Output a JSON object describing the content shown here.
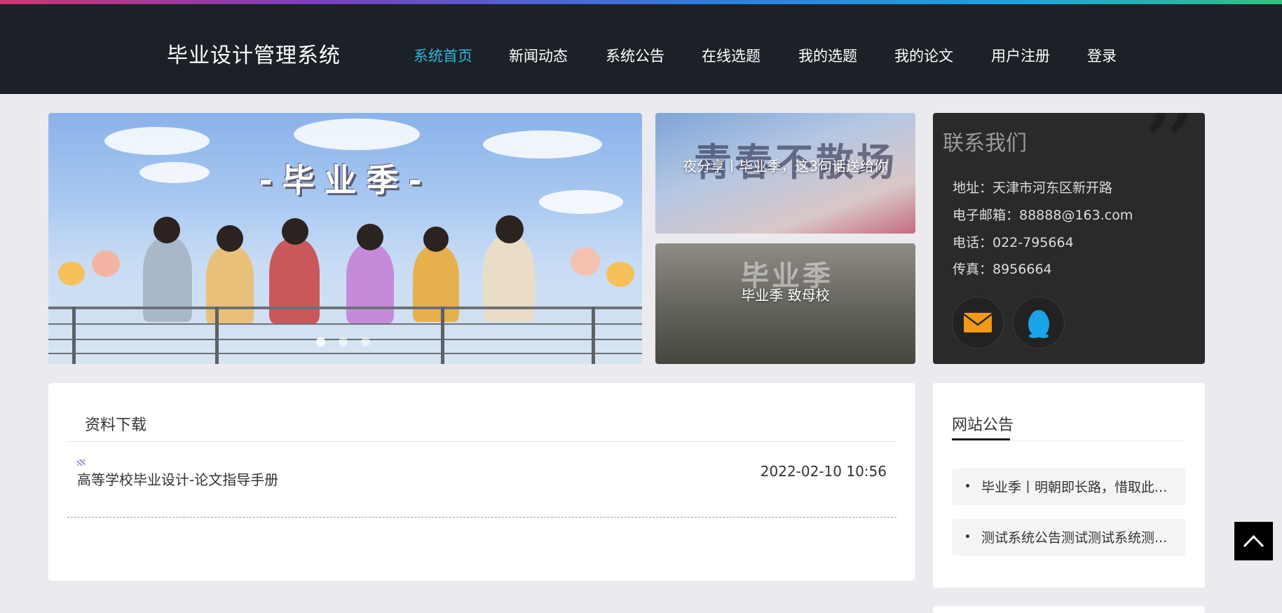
{
  "brand": "毕业设计管理系统",
  "nav": [
    {
      "label": "系统首页",
      "active": true
    },
    {
      "label": "新闻动态",
      "active": false
    },
    {
      "label": "系统公告",
      "active": false
    },
    {
      "label": "在线选题",
      "active": false
    },
    {
      "label": "我的选题",
      "active": false
    },
    {
      "label": "我的论文",
      "active": false
    },
    {
      "label": "用户注册",
      "active": false
    },
    {
      "label": "登录",
      "active": false
    }
  ],
  "colors": {
    "accent": "#33b4dd",
    "header_bg": "#1b2127",
    "page_bg": "#ebebef",
    "contact_bg": "#2a2a2a"
  },
  "hero": {
    "banner_text": "-毕业季-",
    "slides": 3,
    "active_slide": 1
  },
  "news_cards": [
    {
      "caption": "夜分享丨毕业季，这3句话送给你",
      "image_text": "青春不散场"
    },
    {
      "caption": "毕业季 致母校",
      "image_text": "毕业季"
    }
  ],
  "contact": {
    "title": "联系我们",
    "address": "地址：天津市河东区新开路",
    "email": "电子邮箱：88888@163.com",
    "phone": "电话：022-795664",
    "fax": "传真：8956664",
    "icons": [
      "mail-icon",
      "qq-penguin-icon"
    ]
  },
  "downloads": {
    "title": "资料下载",
    "items": [
      {
        "name": "高等学校毕业设计-论文指导手册",
        "date": "2022-02-10 10:56"
      }
    ]
  },
  "notices": {
    "title": "网站公告",
    "items": [
      "毕业季丨明朝即长路，惜取此...",
      "测试系统公告测试测试系统测..."
    ]
  },
  "back_to_top": "chevron-up-icon"
}
